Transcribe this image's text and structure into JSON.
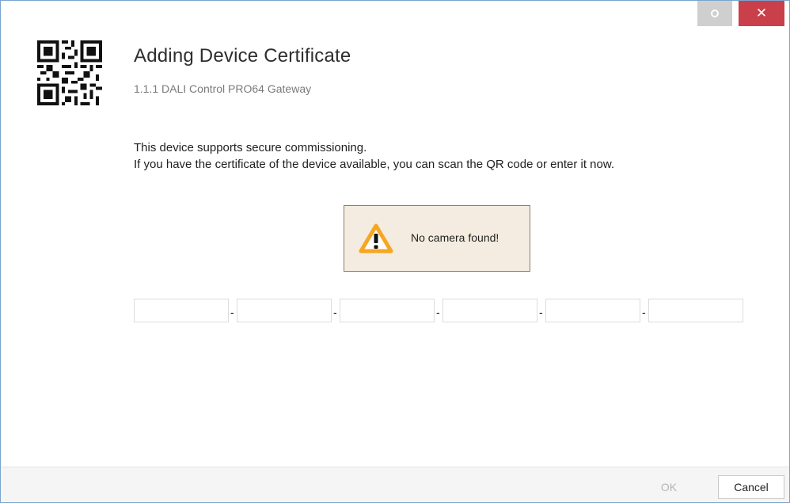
{
  "window": {
    "settings_icon": "settings-ring-icon",
    "close_icon": "close-icon",
    "close_glyph": "✕"
  },
  "header": {
    "qr_icon": "qr-code-icon",
    "title": "Adding Device Certificate",
    "subtitle": "1.1.1 DALI Control PRO64 Gateway"
  },
  "description": {
    "line1": "This device supports secure commissioning.",
    "line2": "If you have the certificate of the device available, you can scan the QR code or enter it now."
  },
  "camera": {
    "icon": "warning-icon",
    "message": "No camera found!"
  },
  "certificate": {
    "separator": "-",
    "fields": [
      {
        "value": ""
      },
      {
        "value": ""
      },
      {
        "value": ""
      },
      {
        "value": ""
      },
      {
        "value": ""
      },
      {
        "value": ""
      }
    ]
  },
  "footer": {
    "ok_label": "OK",
    "cancel_label": "Cancel"
  },
  "colors": {
    "window_border": "#7aa3cf",
    "close_button": "#c9404a",
    "settings_button": "#cfcfcf",
    "warning_fill": "#f6a623",
    "camera_box_bg": "#f4ece0",
    "footer_bg": "#f5f5f5"
  }
}
